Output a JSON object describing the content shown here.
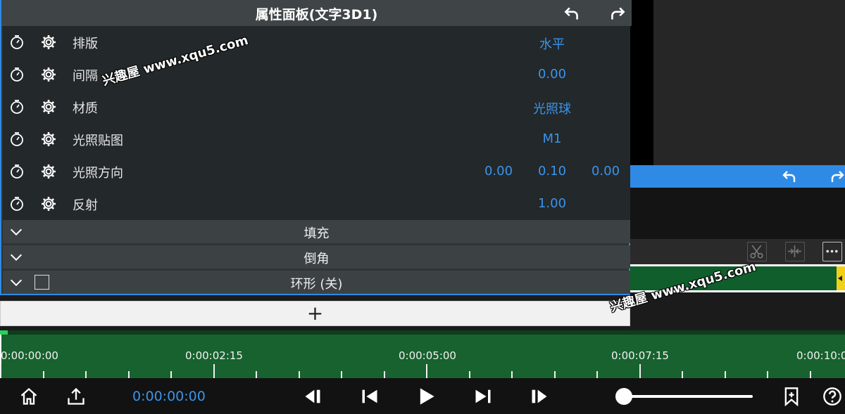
{
  "panel": {
    "title": "属性面板(文字3D1)",
    "undo_icon": "undo-icon",
    "redo_icon": "redo-icon",
    "rows": [
      {
        "label": "排版",
        "values": [
          "水平"
        ]
      },
      {
        "label": "间隔",
        "values": [
          "0.00"
        ]
      },
      {
        "label": "材质",
        "values": [
          "光照球"
        ]
      },
      {
        "label": "光照贴图",
        "values": [
          "M1"
        ]
      },
      {
        "label": "光照方向",
        "values": [
          "0.00",
          "0.10",
          "0.00"
        ]
      },
      {
        "label": "反射",
        "values": [
          "1.00"
        ]
      }
    ],
    "sections": [
      {
        "label": "填充"
      },
      {
        "label": "倒角"
      },
      {
        "label": "环形 (关)",
        "checked": false
      }
    ],
    "add_label": "+"
  },
  "timeline": {
    "labels": [
      "0:00:00:00",
      "0:00:02:15",
      "0:00:05:00",
      "0:00:07:15",
      "0:00:10:0"
    ]
  },
  "transport": {
    "timecode": "0:00:00:00",
    "icons": [
      "home-icon",
      "share-icon",
      "step-back-frame-icon",
      "skip-previous-icon",
      "play-icon",
      "skip-next-icon",
      "step-forward-frame-icon",
      "bookmark-icon",
      "help-icon"
    ]
  },
  "watermark": {
    "text": "兴趣屋 www.xqu5.com"
  },
  "colors": {
    "accent": "#2f8ae6",
    "value_text": "#3a94ea",
    "timeline_green": "#17622e",
    "clip_green": "#0f5e2c",
    "clip_end": "#f2d018"
  }
}
